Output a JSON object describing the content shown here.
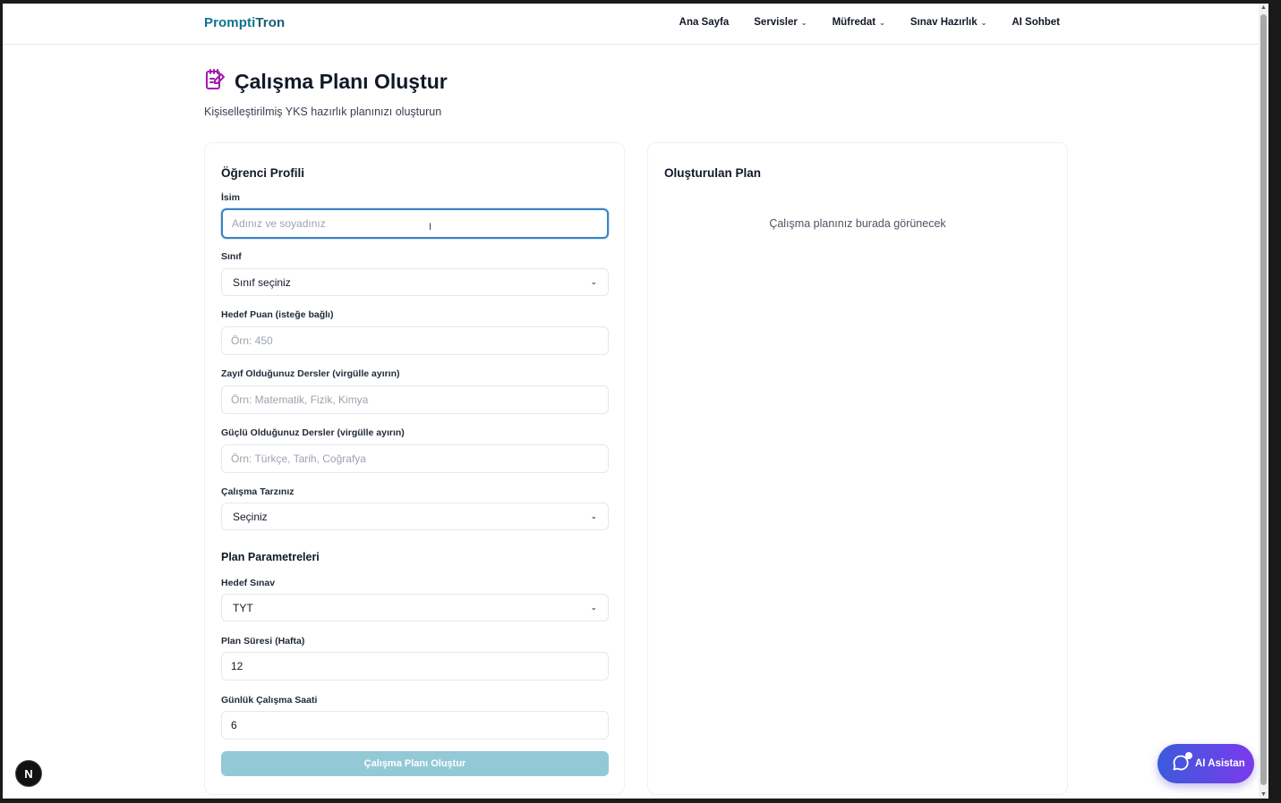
{
  "navbar": {
    "logo_part1": "Prompti",
    "logo_part2": "Tron",
    "links": [
      {
        "label": "Ana Sayfa",
        "has_dropdown": false
      },
      {
        "label": "Servisler",
        "has_dropdown": true
      },
      {
        "label": "Müfredat",
        "has_dropdown": true
      },
      {
        "label": "Sınav Hazırlık",
        "has_dropdown": true
      },
      {
        "label": "AI Sohbet",
        "has_dropdown": false
      }
    ]
  },
  "header": {
    "title": "Çalışma Planı Oluştur",
    "subtitle": "Kişiselleştirilmiş YKS hazırlık planınızı oluşturun",
    "icon": "edit-note-icon"
  },
  "form": {
    "title": "Öğrenci Profili",
    "name_label": "İsim",
    "name_placeholder": "Adınız ve soyadınız",
    "class_label": "Sınıf",
    "class_value": "Sınıf seçiniz",
    "target_score_label": "Hedef Puan (isteğe bağlı)",
    "target_score_placeholder": "Örn: 450",
    "weak_label": "Zayıf Olduğunuz Dersler (virgülle ayırın)",
    "weak_placeholder": "Örn: Matematik, Fizik, Kimya",
    "strong_label": "Güçlü Olduğunuz Dersler (virgülle ayırın)",
    "strong_placeholder": "Örn: Türkçe, Tarih, Coğrafya",
    "style_label": "Çalışma Tarzınız",
    "style_value": "Seçiniz",
    "params_title": "Plan Parametreleri",
    "exam_label": "Hedef Sınav",
    "exam_value": "TYT",
    "weeks_label": "Plan Süresi (Hafta)",
    "weeks_value": "12",
    "hours_label": "Günlük Çalışma Saati",
    "hours_value": "6",
    "submit_label": "Çalışma Planı Oluştur"
  },
  "result": {
    "title": "Oluşturulan Plan",
    "empty_text": "Çalışma planınız burada görünecek"
  },
  "floating": {
    "next_badge": "N",
    "assistant_label": "AI Asistan"
  },
  "colors": {
    "brand": "#0e7490",
    "focus": "#3b82c4",
    "submit_disabled": "#93c9d6",
    "assistant_gradient_start": "#3b5bdb",
    "assistant_gradient_end": "#7c3aed",
    "title_icon": "#a21caf"
  }
}
